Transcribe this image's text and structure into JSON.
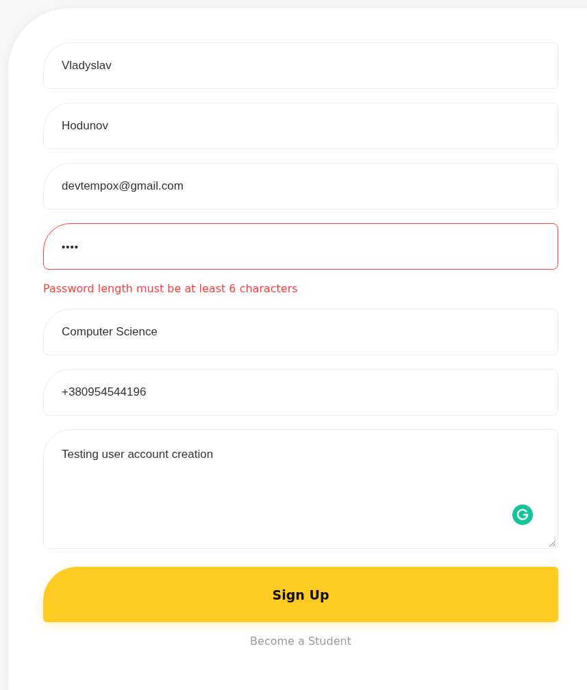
{
  "form": {
    "fields": [
      {
        "kind": "input",
        "value": "Vladyslav",
        "invalid": false
      },
      {
        "kind": "input",
        "value": "Hodunov",
        "invalid": false
      },
      {
        "kind": "input",
        "value": "devtempox@gmail.com",
        "invalid": false
      },
      {
        "kind": "password",
        "value": "••••",
        "invalid": true,
        "error": "Password length must be at least 6 characters"
      },
      {
        "kind": "input",
        "value": "Computer Science",
        "invalid": false
      },
      {
        "kind": "input",
        "value": "+380954544196",
        "invalid": false
      },
      {
        "kind": "textarea",
        "value": "Testing user account creation",
        "invalid": false
      }
    ],
    "submit_button": "Sign Up",
    "link": "Become a Student"
  }
}
